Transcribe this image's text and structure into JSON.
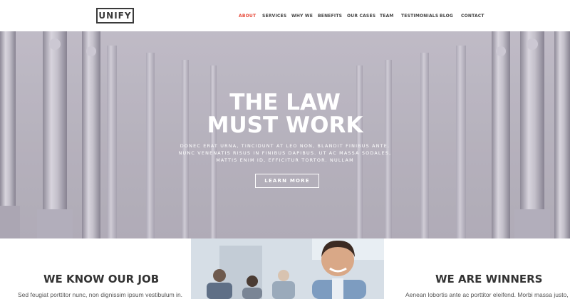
{
  "header": {
    "logo": "UNIFY",
    "nav": [
      {
        "label": "ABOUT",
        "active": true
      },
      {
        "label": "SERVICES",
        "active": false
      },
      {
        "label": "WHY WE",
        "active": false
      },
      {
        "label": "BENEFITS",
        "active": false
      },
      {
        "label": "OUR CASES",
        "active": false
      },
      {
        "label": "TEAM",
        "active": false
      },
      {
        "label": "TESTIMONIALS",
        "active": false
      },
      {
        "label": "BLOG",
        "active": false
      },
      {
        "label": "CONTACT",
        "active": false
      }
    ]
  },
  "hero": {
    "title_line1": "THE LAW",
    "title_line2": "MUST WORK",
    "text_line1": "DONEC ERAT URNA, TINCIDUNT AT LEO NON, BLANDIT FINIBUS ANTE.",
    "text_line2": "NUNC VENENATIS RISUS IN FINIBUS DAPIBUS. UT AC MASSA SODALES,",
    "text_line3": "MATTIS ENIM ID, EFFICITUR TORTOR. NULLAM",
    "button_label": "LEARN MORE"
  },
  "sections": {
    "left": {
      "title": "WE KNOW OUR JOB",
      "text": "Sed feugiat porttitor nunc, non dignissim ipsum vestibulum in."
    },
    "right": {
      "title": "WE ARE WINNERS",
      "text": "Aenean lobortis ante ac porttitor eleifend. Morbi massa justo,"
    }
  },
  "colors": {
    "accent": "#e74c3c",
    "text_dark": "#333333",
    "hero_bg": "#bcb9c2"
  }
}
